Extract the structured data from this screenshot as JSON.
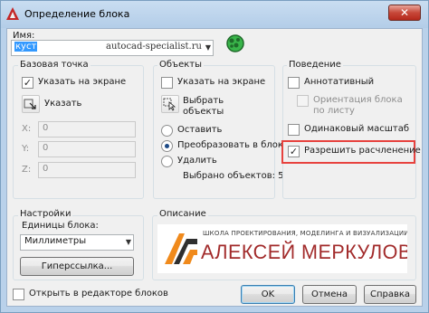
{
  "window": {
    "title": "Определение блока",
    "close_symbol": "✕"
  },
  "name": {
    "label": "Имя:",
    "value": "куст",
    "watermark": "autocad-specialist.ru"
  },
  "base_point": {
    "title": "Базовая точка",
    "specify_on_screen": "Указать на экране",
    "pick_label": "Указать",
    "x_label": "X:",
    "y_label": "Y:",
    "z_label": "Z:",
    "x_value": "0",
    "y_value": "0",
    "z_value": "0"
  },
  "objects": {
    "title": "Объекты",
    "specify_on_screen": "Указать на экране",
    "select_label_1": "Выбрать",
    "select_label_2": "объекты",
    "retain": "Оставить",
    "convert": "Преобразовать в блок",
    "delete": "Удалить",
    "selected_count_text": "Выбрано объектов: 5"
  },
  "behavior": {
    "title": "Поведение",
    "annotative": "Аннотативный",
    "orientation_1": "Ориентация блока",
    "orientation_2": "по листу",
    "uniform_scale": "Одинаковый масштаб",
    "allow_explode": "Разрешить расчленение"
  },
  "settings": {
    "title": "Настройки",
    "units_label": "Единицы блока:",
    "units_value": "Миллиметры",
    "hyperlink": "Гиперссылка..."
  },
  "description": {
    "title": "Описание",
    "banner_top": "ШКОЛА ПРОЕКТИРОВАНИЯ, МОДЕЛИНГА И ВИЗУАЛИЗАЦИИ",
    "banner_name": "АЛЕКСЕЙ МЕРКУЛОВ"
  },
  "footer": {
    "open_in_editor": "Открыть в редакторе блоков",
    "ok": "OK",
    "cancel": "Отмена",
    "help": "Справка"
  },
  "checkmark": "✓",
  "colors": {
    "accent_red": "#e7423e",
    "banner_orange": "#f08a1c",
    "banner_text": "#a22b2b"
  }
}
